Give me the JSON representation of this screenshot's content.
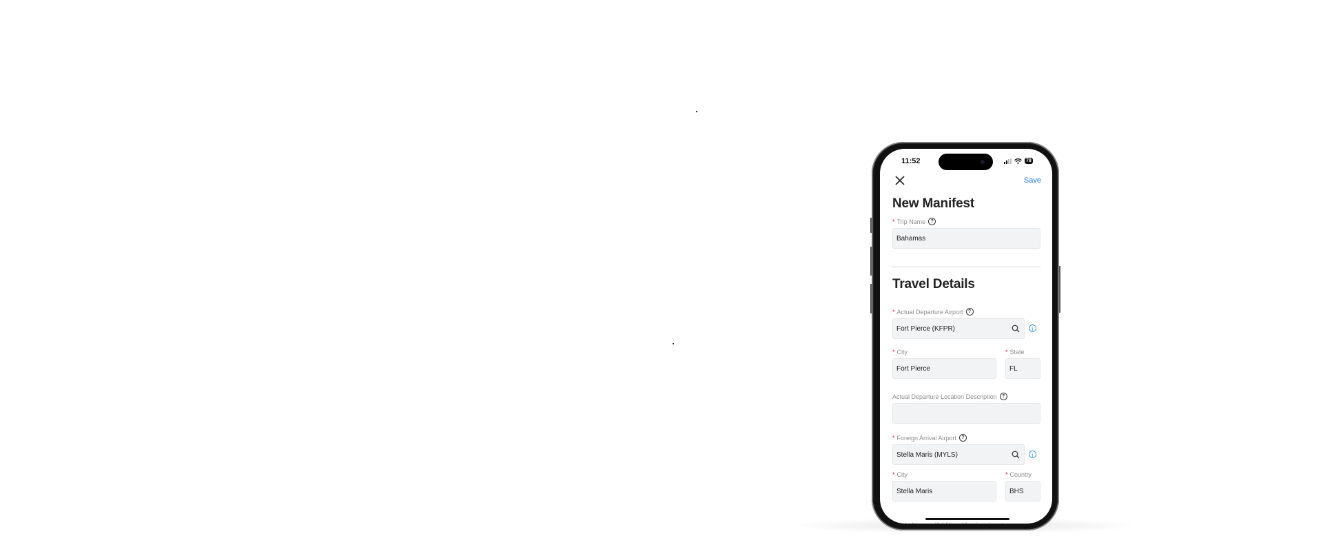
{
  "status_bar": {
    "time": "11:52",
    "battery": "78"
  },
  "nav": {
    "close_icon": "close-icon",
    "save_label": "Save"
  },
  "title": "New Manifest",
  "trip_name": {
    "label": "Trip Name",
    "required": true,
    "value": "Bahamas"
  },
  "section_title": "Travel Details",
  "departure_airport": {
    "label": "Actual Departure Airport",
    "required": true,
    "value": "Fort Pierce (KFPR)"
  },
  "departure_city": {
    "label": "City",
    "required": true,
    "value": "Fort Pierce"
  },
  "departure_state": {
    "label": "State",
    "required": true,
    "value": "FL"
  },
  "departure_location_description": {
    "label": "Actual Departure Location Description",
    "required": false,
    "value": ""
  },
  "arrival_airport": {
    "label": "Foreign Arrival Airport",
    "required": true,
    "value": "Stella Maris (MYLS)"
  },
  "arrival_city": {
    "label": "City",
    "required": true,
    "value": "Stella Maris"
  },
  "arrival_country": {
    "label": "Country",
    "required": true,
    "value": "BHS"
  },
  "next_field_label_partial": "Flight Itinerary/Additional foreign airport",
  "glyphs": {
    "required": "*",
    "help": "?",
    "info": "i"
  },
  "colors": {
    "accent": "#1a73d9",
    "required": "#d32020",
    "info": "#3d9be9"
  }
}
